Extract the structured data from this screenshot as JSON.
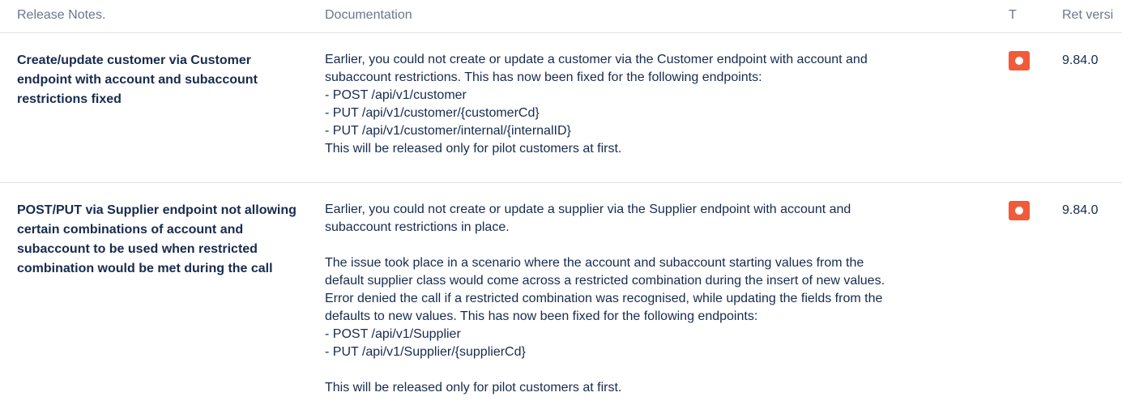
{
  "columns": {
    "release_notes": "Release Notes.",
    "documentation": "Documentation",
    "type": "T",
    "version": "Ret versi"
  },
  "rows": [
    {
      "title": "Create/update customer via Customer endpoint with account and subaccount restrictions fixed",
      "doc_lines": [
        "Earlier, you could not create or update a customer via the Customer endpoint with account and",
        "subaccount restrictions. This has now been fixed for the following endpoints:",
        "- POST /api/v1/customer",
        "- PUT /api/v1/customer/{customerCd}",
        "- PUT /api/v1/customer/internal/{internalID}",
        "This will be released only for pilot customers at first."
      ],
      "type_icon": "bug-icon",
      "type_color": "#f15a3a",
      "version": "9.84.0"
    },
    {
      "title": "POST/PUT via Supplier endpoint not allowing certain combinations of account and subaccount to be used when restricted combination would be met during the call",
      "doc_lines": [
        "Earlier, you could not create or update a supplier via the Supplier endpoint with account and",
        "subaccount restrictions in place.",
        "",
        "The issue took place in a scenario where the account and subaccount starting values from the",
        "default supplier class would come across a restricted combination during the insert of new values.",
        "Error denied the call if a restricted combination was recognised, while updating the fields from the",
        "defaults to new values. This has now been fixed for the following endpoints:",
        "- POST /api/v1/Supplier",
        "- PUT /api/v1/Supplier/{supplierCd}",
        "",
        "This will be released only for pilot customers at first."
      ],
      "type_icon": "bug-icon",
      "type_color": "#f15a3a",
      "version": "9.84.0"
    }
  ]
}
